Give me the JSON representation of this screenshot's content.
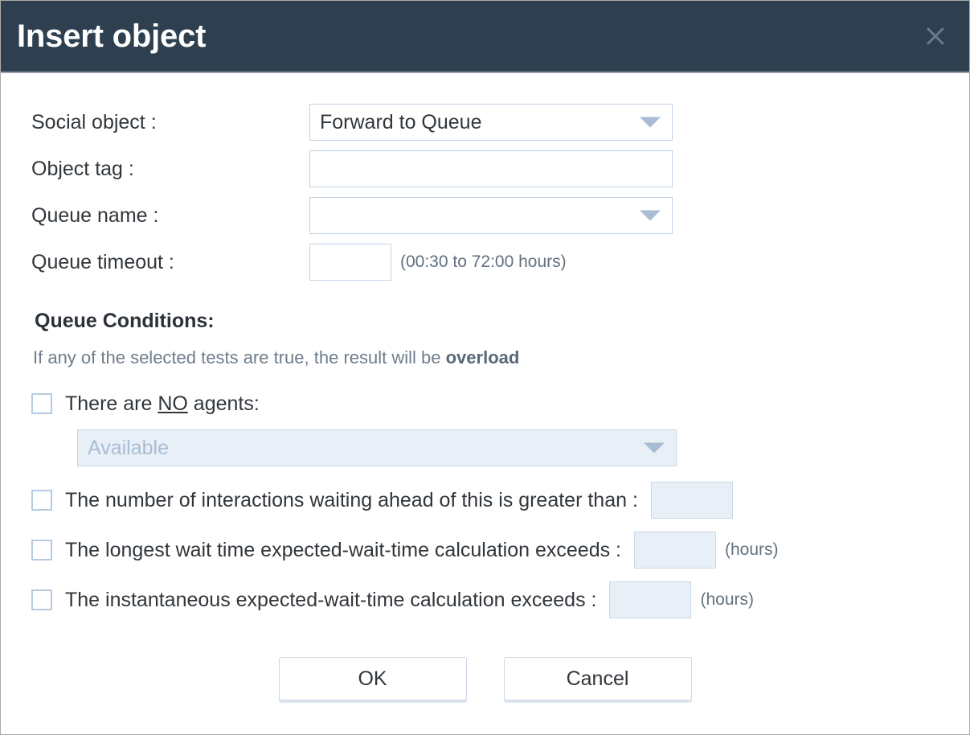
{
  "dialog": {
    "title": "Insert object",
    "close_icon": "close-icon"
  },
  "form": {
    "social_object": {
      "label": "Social object :",
      "value": "Forward to Queue",
      "caret_icon": "chevron-down-icon"
    },
    "object_tag": {
      "label": "Object tag :",
      "value": "",
      "placeholder": ""
    },
    "queue_name": {
      "label": "Queue name :",
      "value": "",
      "caret_icon": "chevron-down-icon"
    },
    "queue_timeout": {
      "label": "Queue timeout :",
      "value": "",
      "hint": "(00:30 to 72:00 hours)"
    }
  },
  "conditions": {
    "title": "Queue Conditions:",
    "subtitle_prefix": "If any of the selected tests are true, the result will be ",
    "subtitle_emphasis": "overload",
    "items": [
      {
        "label_before": "There are ",
        "label_underline": "NO",
        "label_after": " agents:",
        "checked": false,
        "select_value": "Available",
        "select_caret_icon": "chevron-down-icon",
        "select_disabled": true
      },
      {
        "label": "The number of interactions waiting ahead of this is greater than :",
        "checked": false,
        "input_value": "",
        "suffix": ""
      },
      {
        "label": "The longest wait time expected-wait-time calculation exceeds :",
        "checked": false,
        "input_value": "",
        "suffix": "(hours)"
      },
      {
        "label": "The instantaneous expected-wait-time calculation exceeds :",
        "checked": false,
        "input_value": "",
        "suffix": "(hours)"
      }
    ]
  },
  "footer": {
    "ok_label": "OK",
    "cancel_label": "Cancel"
  },
  "colors": {
    "titlebar_bg": "#2e3f50",
    "field_border": "#c2d3e6",
    "disabled_bg": "#e9eff6",
    "text": "#31363b",
    "muted_text": "#6f7d8c",
    "caret": "#a8bcd4"
  }
}
